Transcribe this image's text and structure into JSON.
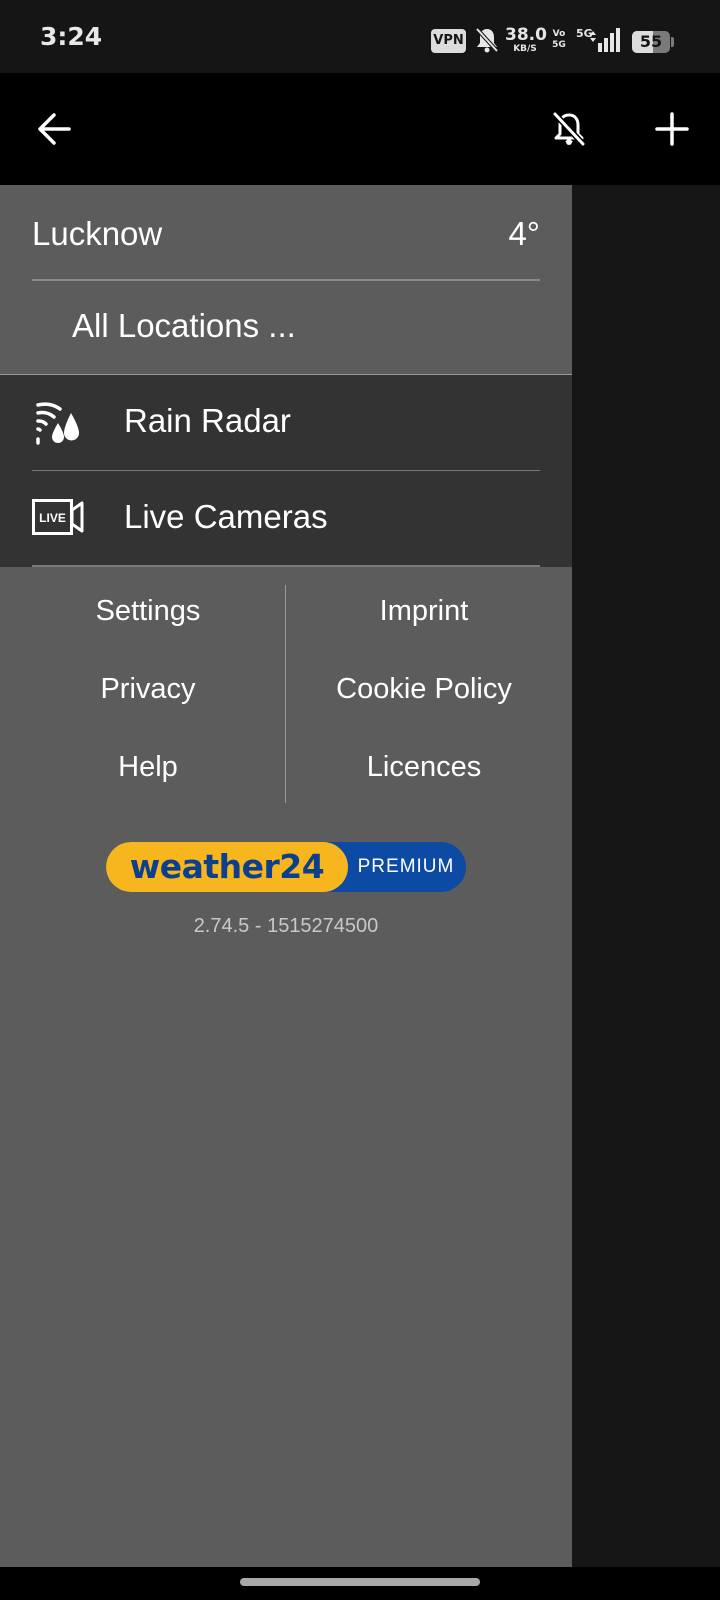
{
  "status_bar": {
    "time": "3:24",
    "vpn_label": "VPN",
    "net_speed_value": "38.0",
    "net_speed_unit": "KB/S",
    "volte_top": "Vo",
    "volte_bottom": "5G",
    "network_type": "5G",
    "battery_level": "55",
    "battery_fraction": 0.55,
    "icons": [
      "vpn-icon",
      "bell-off-icon",
      "signal-icon",
      "battery-icon"
    ]
  },
  "app_bar": {
    "back_icon": "arrow-left-icon",
    "notifications_icon": "bell-off-icon",
    "add_icon": "plus-icon"
  },
  "drawer": {
    "location": {
      "name": "Lucknow",
      "temperature": "4°"
    },
    "all_locations_label": "All Locations ...",
    "menu_items": [
      {
        "label": "Rain Radar",
        "icon": "rain-radar-icon"
      },
      {
        "label": "Live Cameras",
        "icon": "live-camera-icon",
        "icon_text": "LIVE"
      }
    ],
    "links_left": [
      "Settings",
      "Privacy",
      "Help"
    ],
    "links_right": [
      "Imprint",
      "Cookie Policy",
      "Licences"
    ],
    "brand": {
      "name": "weather24",
      "tier": "PREMIUM"
    },
    "version": "2.74.5 - 1515274500"
  },
  "colors": {
    "drawer_bg": "#5c5c5c",
    "menu_bg": "#333333",
    "app_bar_bg": "#000000",
    "brand_yellow": "#f7b61e",
    "brand_blue": "#0d4aa3"
  }
}
